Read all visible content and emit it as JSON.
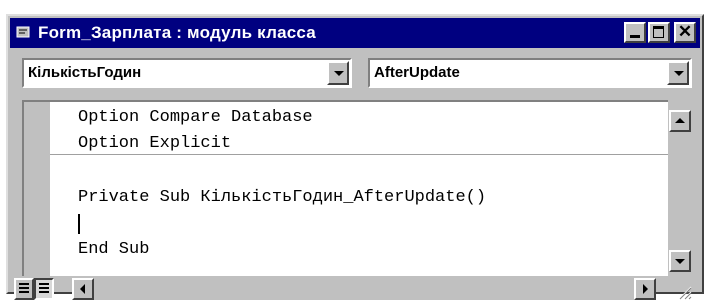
{
  "window": {
    "title": "Form_Зарплата : модуль класса",
    "controls": {
      "minimize": "minimize",
      "maximize": "maximize",
      "close": "✕"
    }
  },
  "object_dropdown": {
    "selected": "КількістьГодин"
  },
  "procedure_dropdown": {
    "selected": "AfterUpdate"
  },
  "code": {
    "declarations": [
      "Option Compare Database",
      "Option Explicit"
    ],
    "procedure_lines": [
      "Private Sub КількістьГодин_AfterUpdate()",
      "",
      "End Sub"
    ]
  },
  "icons": {
    "title": "vba-module-icon",
    "procedure_view": "procedure-view-icon",
    "full_module_view": "full-module-view-icon"
  },
  "colors": {
    "titlebar": "#000080",
    "chrome": "#c0c0c0",
    "watermark": "#cfe3ef"
  }
}
